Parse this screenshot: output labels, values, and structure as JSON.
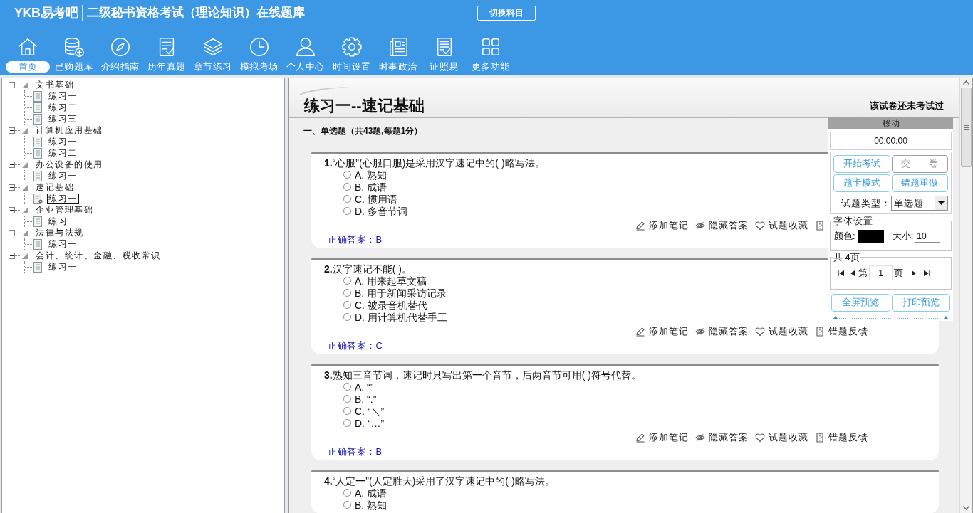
{
  "header": {
    "logo": "YKB易考吧",
    "title": "二级秘书资格考试（理论知识）在线题库",
    "switch_button": "切换科目"
  },
  "nav": [
    {
      "kind": "home",
      "label": "首页",
      "selected": true
    },
    {
      "kind": "purchased",
      "label": "已购题库",
      "selected": false
    },
    {
      "kind": "guide",
      "label": "介绍指南",
      "selected": false
    },
    {
      "kind": "past",
      "label": "历年真题",
      "selected": false
    },
    {
      "kind": "chapter",
      "label": "章节练习",
      "selected": false
    },
    {
      "kind": "mock",
      "label": "模拟考场",
      "selected": false
    },
    {
      "kind": "personal",
      "label": "个人中心",
      "selected": false
    },
    {
      "kind": "time",
      "label": "时间设置",
      "selected": false
    },
    {
      "kind": "news",
      "label": "时事政治",
      "selected": false
    },
    {
      "kind": "cert",
      "label": "证照易",
      "selected": false
    },
    {
      "kind": "more",
      "label": "更多功能",
      "selected": false
    }
  ],
  "tree": [
    {
      "label": "文书基础",
      "expanded": true,
      "children": [
        {
          "label": "练习一",
          "selected": false
        },
        {
          "label": "练习二",
          "selected": false
        },
        {
          "label": "练习三",
          "selected": false
        }
      ]
    },
    {
      "label": "计算机应用基础",
      "expanded": true,
      "children": [
        {
          "label": "练习一",
          "selected": false
        },
        {
          "label": "练习二",
          "selected": false
        }
      ]
    },
    {
      "label": "办公设备的使用",
      "expanded": true,
      "children": [
        {
          "label": "练习一",
          "selected": false
        }
      ]
    },
    {
      "label": "速记基础",
      "expanded": true,
      "children": [
        {
          "label": "练习一",
          "selected": true
        }
      ]
    },
    {
      "label": "企业管理基础",
      "expanded": true,
      "children": [
        {
          "label": "练习一",
          "selected": false
        }
      ]
    },
    {
      "label": "法律与法规",
      "expanded": true,
      "children": [
        {
          "label": "练习一",
          "selected": false
        }
      ]
    },
    {
      "label": "会计、统计、金融、税收常识",
      "expanded": true,
      "children": [
        {
          "label": "练习一",
          "selected": false
        }
      ]
    }
  ],
  "paper": {
    "title": "练习一--速记基础",
    "status": "该试卷还未考试过",
    "section": "一、单选题（共43题,每题1分）",
    "questions": [
      {
        "stem": "**1.**“心服”(心服口服)是采用汉字速记中的( )略写法。",
        "options": [
          {
            "text": "A. 熟知",
            "checked": false
          },
          {
            "text": "B. 成语",
            "checked": false
          },
          {
            "text": "C. 惯用语",
            "checked": false
          },
          {
            "text": "D. 多音节词",
            "checked": false
          }
        ],
        "actions": [
          {
            "kind": "note",
            "label": "添加笔记"
          },
          {
            "kind": "hide",
            "label": "隐藏答案"
          },
          {
            "kind": "favorite",
            "label": "试题收藏"
          },
          {
            "kind": "feedback"
          }
        ],
        "answer": "正确答案：B"
      },
      {
        "stem": "**2.**汉字速记不能( )。",
        "options": [
          {
            "text": "A. 用来起草文稿",
            "checked": false
          },
          {
            "text": "B. 用于新闻采访记录",
            "checked": false
          },
          {
            "text": "C. 被录音机替代",
            "checked": false
          },
          {
            "text": "D. 用计算机代替手工",
            "checked": false
          }
        ],
        "actions": [
          {
            "kind": "note",
            "label": "添加笔记"
          },
          {
            "kind": "hide",
            "label": "隐藏答案"
          },
          {
            "kind": "favorite",
            "label": "试题收藏"
          },
          {
            "kind": "feedback",
            "label": "错题反馈"
          }
        ],
        "answer": "正确答案：C"
      },
      {
        "stem": "**3.**熟知三音节词，速记时只写出第一个音节，后两音节可用( )符号代替。",
        "options": [
          {
            "text": "A. “”",
            "checked": false
          },
          {
            "text": "B. “.”",
            "checked": false
          },
          {
            "text": "C. “＼”",
            "checked": false
          },
          {
            "text": "D. “…”",
            "checked": false
          }
        ],
        "actions": [
          {
            "kind": "note",
            "label": "添加笔记"
          },
          {
            "kind": "hide",
            "label": "隐藏答案"
          },
          {
            "kind": "favorite",
            "label": "试题收藏"
          },
          {
            "kind": "feedback",
            "label": "错题反馈"
          }
        ],
        "answer": "正确答案：B"
      },
      {
        "stem": "**4.**“人定一”(人定胜天)采用了汉字速记中的( )略写法。",
        "options": [
          {
            "text": "A. 成语",
            "checked": false
          },
          {
            "text": "B. 熟知",
            "checked": false
          }
        ]
      }
    ]
  },
  "panel": {
    "title": "移动",
    "timer": "00:00:00",
    "buttons": [
      {
        "label": "开始考试",
        "disabled": false
      },
      {
        "label": "交　　卷",
        "disabled": true
      },
      {
        "label": "题卡模式",
        "disabled": false
      },
      {
        "label": "错题重做",
        "disabled": false
      }
    ],
    "type_label": "试题类型：",
    "type_value": "单选题",
    "font_settings": {
      "legend": "字体设置",
      "color_label": "颜色:",
      "color": "#000000",
      "size_label": "大小:",
      "size": "10"
    },
    "pager": {
      "legend": "共 4页",
      "page_prefix": "第",
      "page": "1",
      "page_suffix": "页"
    },
    "preview_buttons": [
      {
        "label": "全屏预览",
        "disabled": false
      },
      {
        "label": "打印预览",
        "disabled": false
      }
    ]
  }
}
